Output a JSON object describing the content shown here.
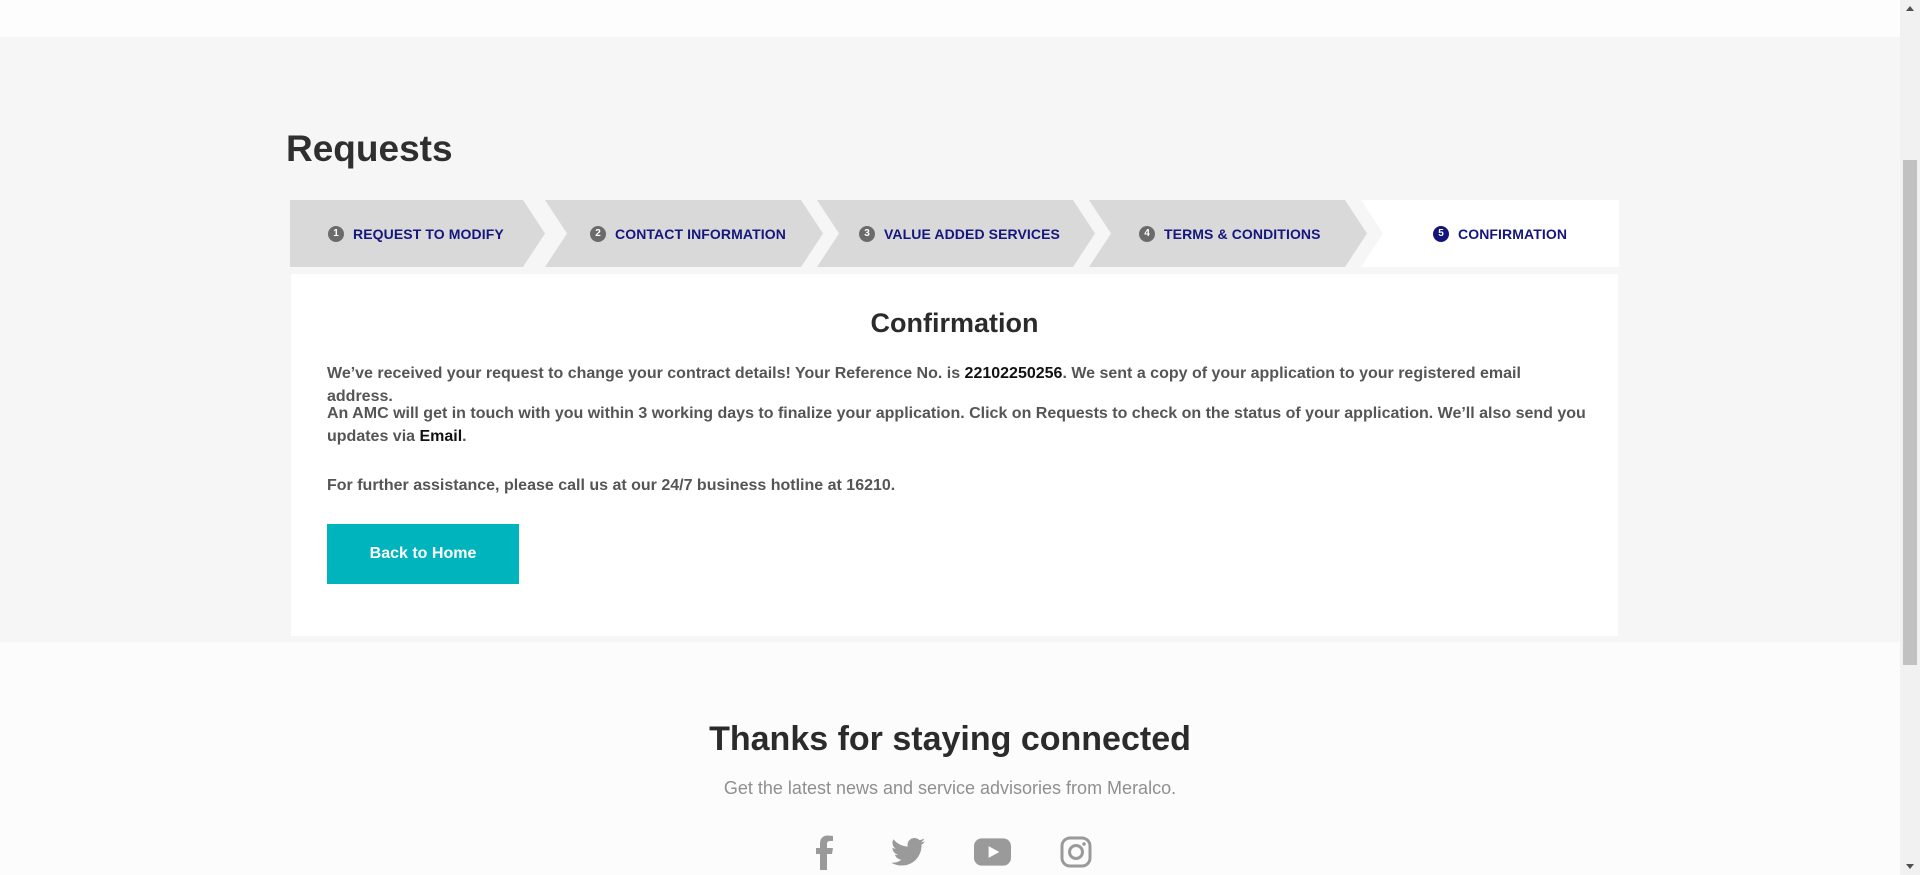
{
  "page": {
    "title": "Requests"
  },
  "stepper": {
    "steps": [
      {
        "number": "1",
        "label": "REQUEST TO MODIFY",
        "state": "completed"
      },
      {
        "number": "2",
        "label": "CONTACT INFORMATION",
        "state": "completed"
      },
      {
        "number": "3",
        "label": "VALUE ADDED SERVICES",
        "state": "completed"
      },
      {
        "number": "4",
        "label": "TERMS & CONDITIONS",
        "state": "completed"
      },
      {
        "number": "5",
        "label": "CONFIRMATION",
        "state": "active"
      }
    ]
  },
  "confirmation": {
    "title": "Confirmation",
    "p1_before": "We’ve received your request to change your contract details! Your Reference No. is ",
    "reference_no": "22102250256",
    "p1_after": ". We sent a copy of your application to your registered email address.",
    "p2_before": "An AMC will get in touch with you within 3 working days to finalize your application. Click on Requests to check on the status of your application. We’ll also send you updates via ",
    "p2_channel": "Email",
    "p2_after": ".",
    "p3": "For further assistance, please call us at our 24/7 business hotline at 16210.",
    "back_button_label": "Back to Home"
  },
  "footer": {
    "title": "Thanks for staying connected",
    "subtitle": "Get the latest news and service advisories from Meralco.",
    "socials": [
      "facebook-icon",
      "twitter-icon",
      "youtube-icon",
      "instagram-icon"
    ]
  },
  "colors": {
    "accent_teal": "#00b4bd",
    "step_navy": "#14167d",
    "step_inactive_bg": "#d9d9d9",
    "page_bg": "#f6f6f6"
  }
}
